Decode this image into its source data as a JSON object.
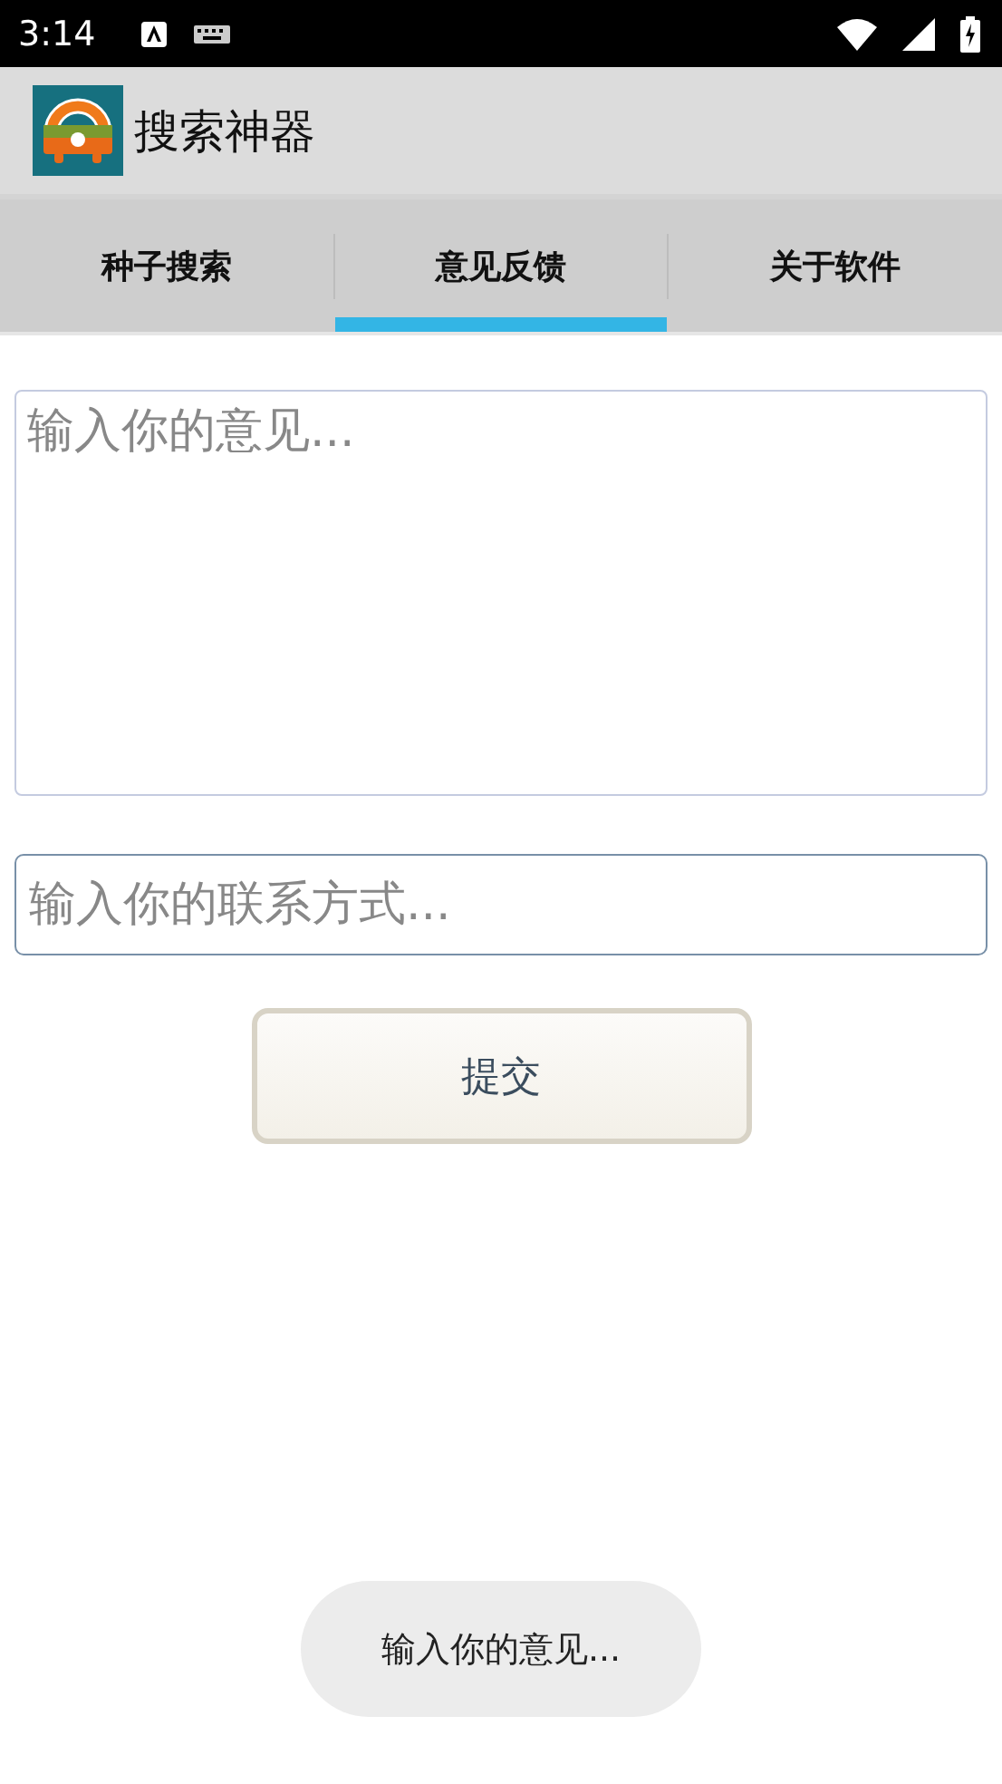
{
  "status_bar": {
    "time": "3:14"
  },
  "app_bar": {
    "title": "搜索神器"
  },
  "tabs": [
    {
      "label": "种子搜索",
      "selected": false
    },
    {
      "label": "意见反馈",
      "selected": true
    },
    {
      "label": "关于软件",
      "selected": false
    }
  ],
  "feedback_field": {
    "placeholder": "输入你的意见..."
  },
  "contact_field": {
    "placeholder": "输入你的联系方式..."
  },
  "submit_button": {
    "label": "提交"
  },
  "toast": {
    "text": "输入你的意见..."
  }
}
